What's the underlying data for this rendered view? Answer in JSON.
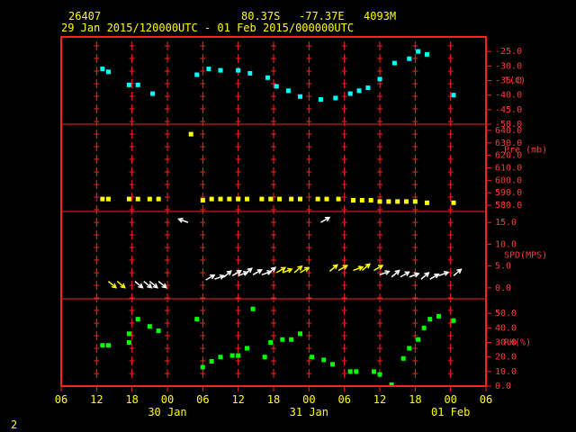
{
  "header": {
    "station": "26407",
    "lat": "80.37S",
    "lon": "-77.37E",
    "elev": "4093M",
    "range": "29 Jan 2015/120000UTC - 01 Feb 2015/000000UTC"
  },
  "page_number": "2",
  "colors": {
    "frame": "#ff2020",
    "header": "#ffff00",
    "temp": "#00ffff",
    "pres": "#ffff00",
    "wind_yellow": "#ffff00",
    "wind_white": "#ffffff",
    "rh": "#00ff00"
  },
  "chart_data": [
    {
      "type": "scatter",
      "title": "",
      "ylabel": "T(C)",
      "ylim": [
        -50,
        -20
      ],
      "yticks": [
        "-25.0",
        "-30.0",
        "-35.0",
        "-40.0",
        "-45.0",
        "-50.0"
      ],
      "x_unit": "hours since 30 Jan 00 UTC",
      "x": [
        -11,
        -10,
        -6.5,
        -5,
        -2.5,
        5,
        7,
        9,
        12,
        14,
        17,
        18.5,
        20.5,
        22.5,
        26,
        28.5,
        31,
        32.5,
        34,
        36,
        38.5,
        41,
        42.5,
        44,
        48.5
      ],
      "values": [
        -31,
        -32,
        -36.5,
        -36.5,
        -39.5,
        -33,
        -31,
        -31.5,
        -31.5,
        -32.5,
        -34,
        -37,
        -38.5,
        -40.5,
        -41.5,
        -41,
        -39.5,
        -38.5,
        -37.5,
        -34.5,
        -29,
        -27.5,
        -25,
        -26,
        -40
      ]
    },
    {
      "type": "scatter",
      "ylabel": "Pre (mb)",
      "ylim": [
        575,
        645
      ],
      "yticks": [
        "640.0",
        "630.0",
        "620.0",
        "610.0",
        "600.0",
        "590.0",
        "580.0"
      ],
      "x": [
        -11,
        -10,
        -6.5,
        -5,
        -3,
        -1.5,
        4,
        6,
        7.5,
        9,
        10.5,
        12,
        13.5,
        16,
        17.5,
        19,
        21,
        22.5,
        25.5,
        27,
        29,
        31.5,
        33,
        34.5,
        36,
        37.5,
        39,
        40.5,
        42,
        44,
        48.5
      ],
      "values": [
        585,
        585,
        585,
        585,
        585,
        585,
        637,
        584,
        585,
        585,
        585,
        585,
        585,
        585,
        585,
        585,
        585,
        585,
        585,
        585,
        585,
        584,
        584,
        584,
        583,
        583,
        583,
        583,
        583,
        582,
        582
      ]
    },
    {
      "type": "scatter",
      "ylabel": "SPD(MPS)",
      "ylim": [
        -2.5,
        17.5
      ],
      "yticks": [
        "15.0",
        "10.0",
        "5.0",
        "0.0"
      ],
      "x": [
        -10,
        -8.5,
        -5.5,
        -4,
        -3,
        -1.5,
        3.5,
        6.5,
        8,
        9.5,
        11,
        12,
        13,
        14.5,
        16,
        17,
        18.5,
        19.5,
        21.5,
        22.5,
        26,
        27.5,
        29,
        31.5,
        33,
        35,
        36,
        38,
        39.5,
        41,
        43,
        44.5,
        46,
        48.5
      ],
      "values": [
        1.5,
        1.5,
        1.5,
        1.5,
        1.5,
        1.5,
        15,
        1.8,
        2,
        2.4,
        2.8,
        2.8,
        3,
        3,
        3,
        3.2,
        3.5,
        3.5,
        3.5,
        3.5,
        15,
        3.8,
        4,
        4,
        4,
        4,
        3,
        2.5,
        2.5,
        2.5,
        2,
        2,
        2.8,
        2.8
      ]
    },
    {
      "type": "scatter",
      "ylabel": "RH(%)",
      "ylim": [
        0,
        60
      ],
      "yticks": [
        "50.0",
        "40.0",
        "30.0",
        "20.0",
        "10.0",
        "0.0"
      ],
      "x": [
        -11,
        -10,
        -6.5,
        -6.5,
        -5,
        -3,
        -1.5,
        5,
        6,
        7.5,
        9,
        11,
        12,
        13.5,
        14.5,
        16.5,
        17.5,
        19.5,
        21,
        22.5,
        24.5,
        26.5,
        28,
        31,
        32,
        35,
        36,
        38,
        40,
        41,
        42.5,
        43.5,
        44.5,
        46,
        48.5
      ],
      "values": [
        28,
        28,
        36,
        30,
        46,
        41,
        38,
        46,
        13,
        17,
        20,
        21,
        21,
        26,
        53,
        20,
        30,
        32,
        32,
        36,
        20,
        18,
        15,
        10,
        10,
        10,
        8,
        1,
        19,
        26,
        32,
        40,
        46,
        48,
        45
      ]
    }
  ],
  "x_axis": {
    "ticks": [
      "06",
      "12",
      "18",
      "00",
      "06",
      "12",
      "18",
      "00",
      "06",
      "12",
      "18",
      "00",
      "06"
    ],
    "day_labels": [
      "30 Jan",
      "31 Jan",
      "01 Feb"
    ]
  }
}
